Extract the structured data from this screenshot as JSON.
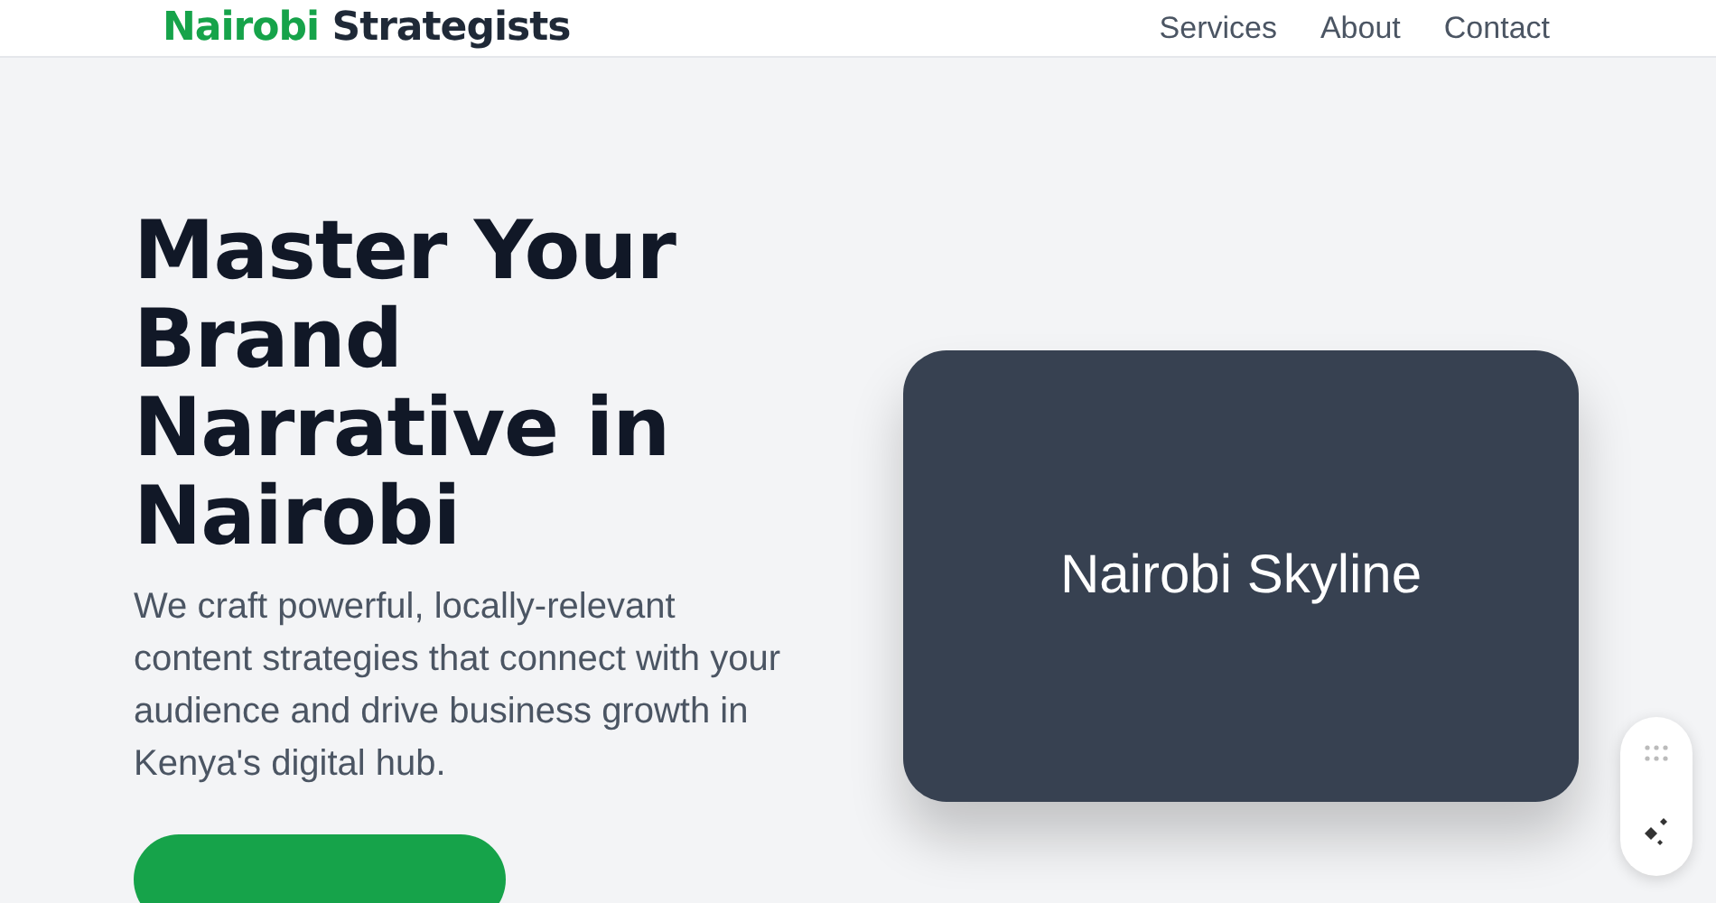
{
  "header": {
    "logo": {
      "accent": "Nairobi",
      "rest": "Strategists"
    },
    "nav": [
      "Services",
      "About",
      "Contact"
    ]
  },
  "hero": {
    "heading": "Master Your Brand Narrative in Nairobi",
    "text": "We craft powerful, locally-relevant content strategies that connect with your audience and drive business growth in Kenya's digital hub.",
    "image_label": "Nairobi Skyline"
  }
}
